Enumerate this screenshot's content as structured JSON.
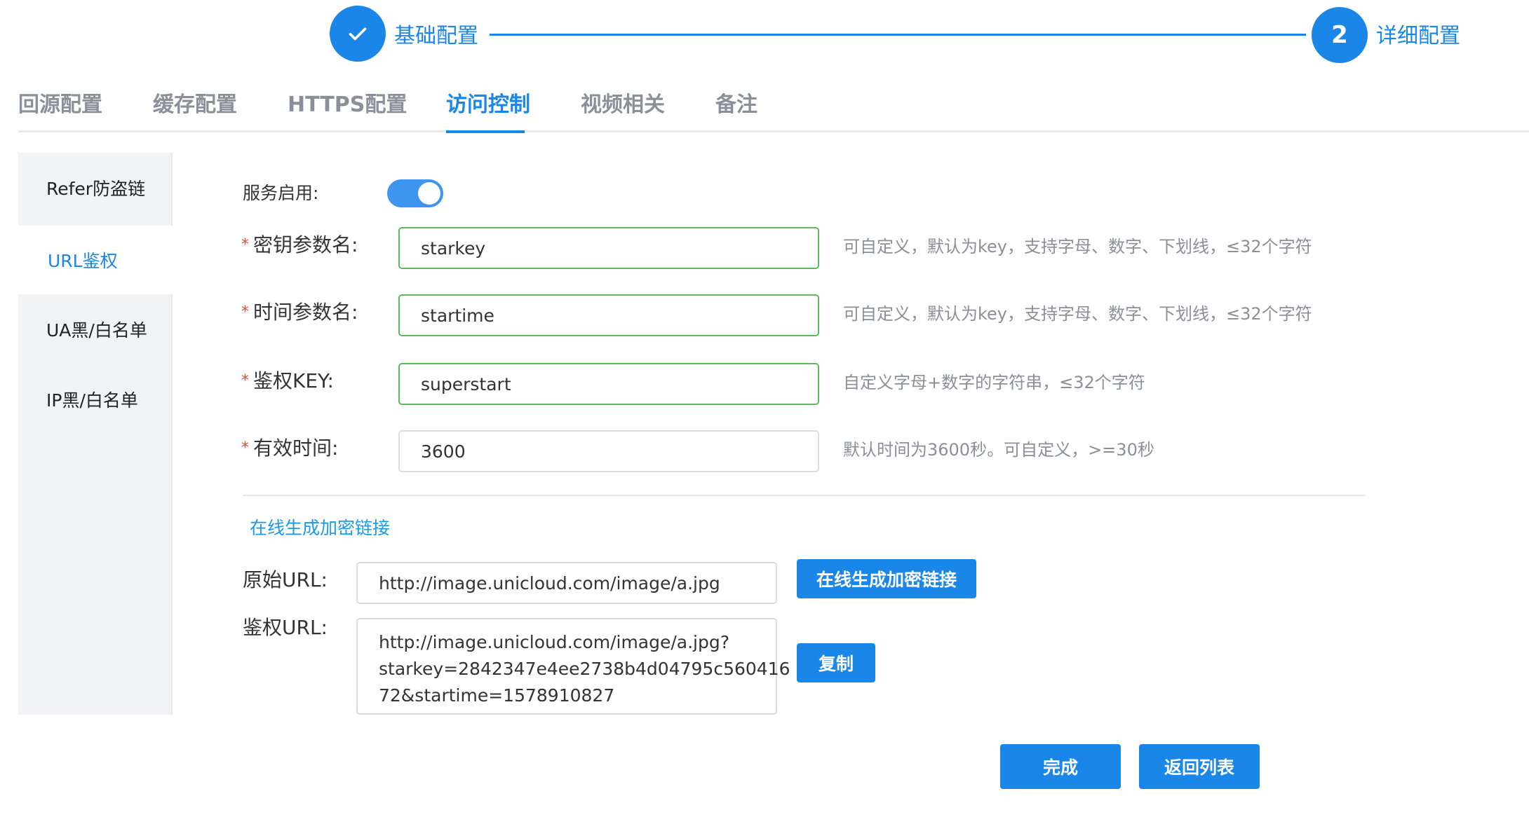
{
  "steps": [
    {
      "label": "基础配置",
      "number": "",
      "status": "done"
    },
    {
      "label": "详细配置",
      "number": "2",
      "status": "current"
    }
  ],
  "tabs": [
    "回源配置",
    "缓存配置",
    "HTTPS配置",
    "访问控制",
    "视频相关",
    "备注"
  ],
  "active_tab": "访问控制",
  "menu": [
    "Refer防盗链",
    "URL鉴权",
    "UA黑/白名单",
    "IP黑/白名单"
  ],
  "active_menu": "URL鉴权",
  "form": {
    "service_label": "服务启用:",
    "service_enabled": true,
    "key_param": {
      "label": "密钥参数名:",
      "value": "starkey",
      "hint": "可自定义，默认为key，支持字母、数字、下划线，≤32个字符"
    },
    "time_param": {
      "label": "时间参数名:",
      "value": "startime",
      "hint": "可自定义，默认为key，支持字母、数字、下划线，≤32个字符"
    },
    "auth_key": {
      "label": "鉴权KEY:",
      "value": "superstart",
      "hint": "自定义字母+数字的字符串，≤32个字符"
    },
    "valid_time": {
      "label": "有效时间:",
      "value": "3600",
      "hint": "默认时间为3600秒。可自定义，>=30秒"
    }
  },
  "generator": {
    "section_link": "在线生成加密链接",
    "origin_label": "原始URL:",
    "origin_value": "http://image.unicloud.com/image/a.jpg",
    "generate_button": "在线生成加密链接",
    "auth_label": "鉴权URL:",
    "auth_lines": [
      "http://image.unicloud.com/image/a.jpg?",
      "starkey=2842347e4ee2738b4d04795c560416",
      "72&startime=1578910827"
    ],
    "copy_button": "复制"
  },
  "footer": {
    "finish_button": "完成",
    "back_button": "返回列表"
  },
  "colors": {
    "primary": "#1a86e8",
    "required": "#e84b3c",
    "valid_border": "#5cb85c"
  }
}
